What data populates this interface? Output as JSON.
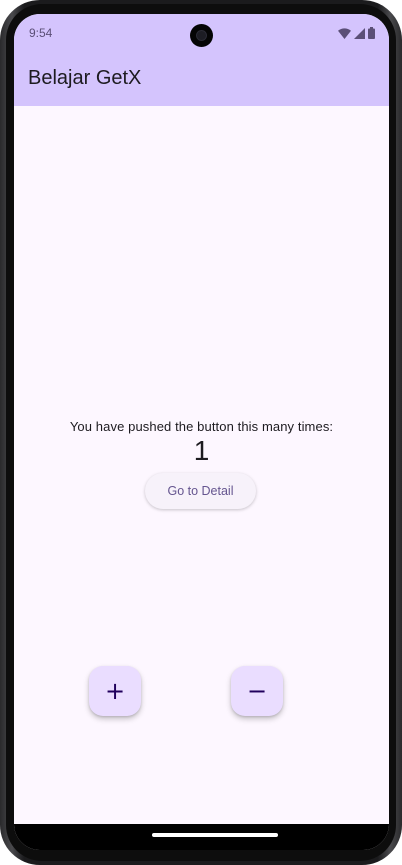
{
  "status_bar": {
    "time": "9:54",
    "icons": [
      "wifi-icon",
      "signal-icon",
      "battery-icon"
    ]
  },
  "app_bar": {
    "title": "Belajar GetX"
  },
  "main": {
    "message": "You have pushed the button this many times:",
    "counter": "1",
    "detail_button_label": "Go to Detail"
  },
  "fabs": {
    "add_label": "+",
    "remove_label": "−"
  },
  "colors": {
    "app_bar_background": "#d4c4fd",
    "page_background": "#fdf7ff",
    "fab_background": "#eaddff",
    "button_text": "#65558f"
  }
}
